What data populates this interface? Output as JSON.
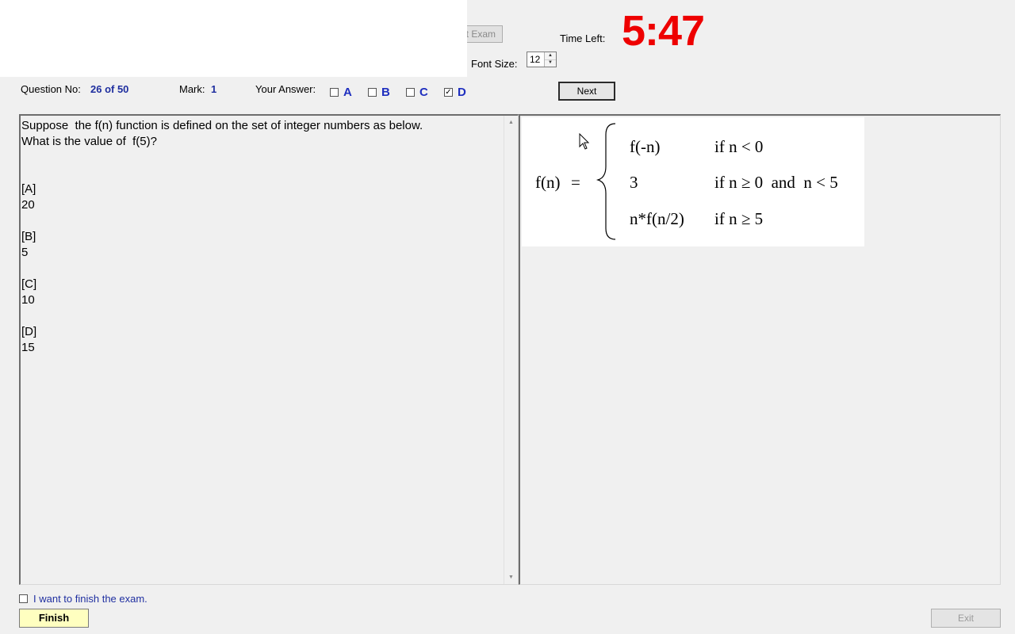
{
  "header": {
    "start_exam_label": "rt Exam",
    "time_left_label": "Time Left:",
    "timer": "5:47",
    "font_size_label": "Font Size:",
    "font_size_value": "12"
  },
  "question_info": {
    "question_no_label": "Question No:",
    "question_no_value": "26 of 50",
    "mark_label": "Mark:",
    "mark_value": "1",
    "your_answer_label": "Your Answer:",
    "options": [
      {
        "letter": "A",
        "checked": false
      },
      {
        "letter": "B",
        "checked": false
      },
      {
        "letter": "C",
        "checked": false
      },
      {
        "letter": "D",
        "checked": true
      }
    ],
    "next_label": "Next"
  },
  "question": {
    "text": "Suppose  the f(n) function is defined on the set of integer numbers as below.\nWhat is the value of  f(5)?\n\n\n[A]\n20\n\n[B]\n5\n\n[C]\n10\n\n[D]\n15"
  },
  "formula": {
    "lhs": "f(n)",
    "equals": "=",
    "cases": [
      {
        "expr": "f(-n)",
        "cond": "if n < 0"
      },
      {
        "expr": "3",
        "cond": "if n ≥ 0  and  n < 5"
      },
      {
        "expr": "n*f(n/2)",
        "cond": "if n ≥ 5"
      }
    ]
  },
  "footer": {
    "finish_checkbox_label": "I want to finish the exam.",
    "finish_checked": false,
    "finish_label": "Finish",
    "exit_label": "Exit"
  },
  "colors": {
    "timer": "#ee0000",
    "accent_text": "#1f2f9f",
    "finish_button": "#ffffc0"
  },
  "icons": {
    "spinner_up": "chevron-up-icon",
    "spinner_down": "chevron-down-icon",
    "scroll_up": "scroll-up-arrow-icon",
    "scroll_down": "scroll-down-arrow-icon",
    "cursor": "mouse-pointer-icon",
    "check": "checkmark-icon"
  }
}
